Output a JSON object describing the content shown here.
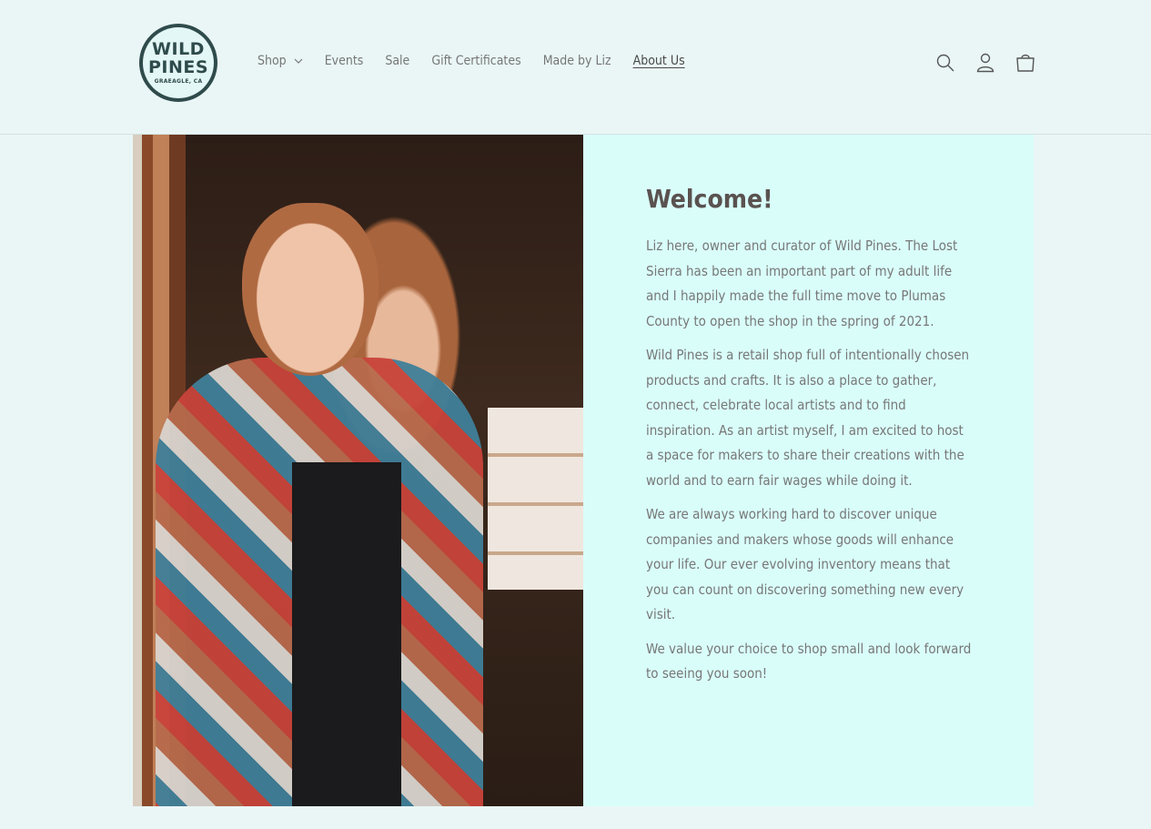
{
  "logo": {
    "line1": "WILD",
    "line2": "PINES",
    "sub": "GRAEAGLE, CA"
  },
  "nav": {
    "items": [
      {
        "label": "Shop"
      },
      {
        "label": "Events"
      },
      {
        "label": "Sale"
      },
      {
        "label": "Gift Certificates"
      },
      {
        "label": "Made by Liz"
      },
      {
        "label": "About Us"
      }
    ],
    "active": "About Us"
  },
  "header_icons": [
    "search-icon",
    "account-icon",
    "cart-icon"
  ],
  "content": {
    "title": "Welcome!",
    "paragraphs": [
      "Liz here, owner and curator of Wild Pines. The Lost Sierra has been an important part of my adult life and I happily made the full time move to Plumas County to open the shop in the spring of 2021.",
      "Wild Pines is a retail shop full of intentionally chosen products and crafts. It is also a place to gather, connect, celebrate local artists and to find inspiration. As an artist myself, I am excited to host a space for makers to share their creations with the world and to earn fair wages while doing it.",
      "We are always working hard to discover unique companies and makers whose goods will enhance your life. Our ever evolving inventory means that you can count on discovering something new every visit.",
      "We value your choice to shop small and look forward to seeing you soon!"
    ]
  },
  "colors": {
    "page_bg": "#eaf6f6",
    "panel_bg": "#d9fefa",
    "logo": "#2f4b4b"
  }
}
